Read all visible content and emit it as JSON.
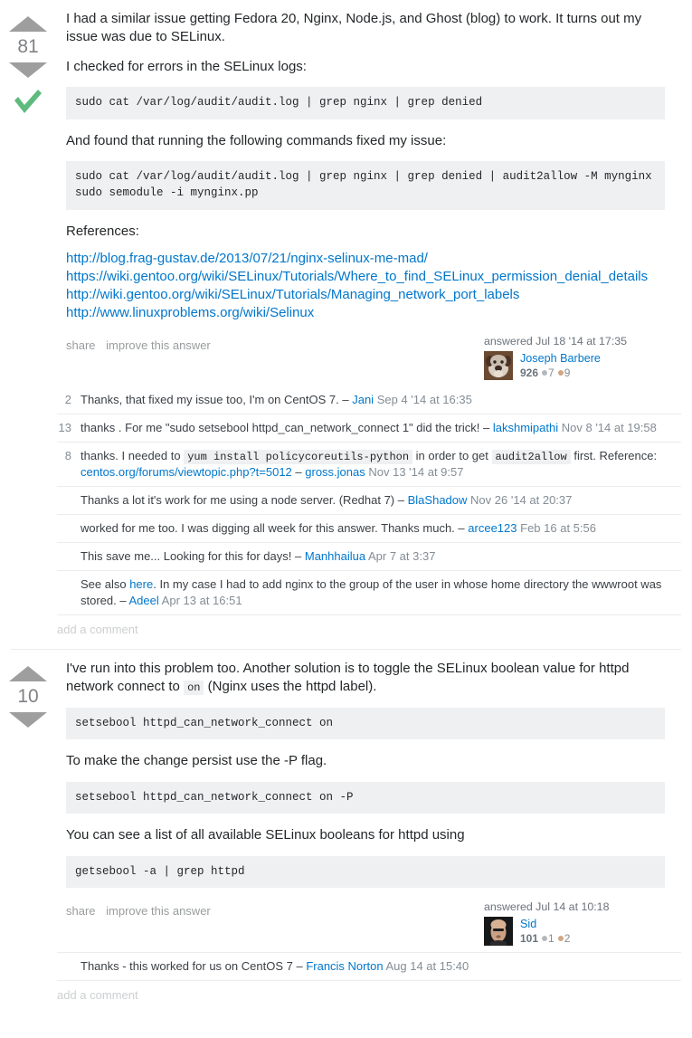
{
  "answers": [
    {
      "vote_count": "81",
      "accepted": true,
      "accept_icon": "checkmark-icon",
      "paragraphs": [
        "I had a similar issue getting Fedora 20, Nginx, Node.js, and Ghost (blog) to work. It turns out my issue was due to SELinux.",
        "I checked for errors in the SELinux logs:",
        "And found that running the following commands fixed my issue:",
        "References:"
      ],
      "code_blocks": [
        "sudo cat /var/log/audit/audit.log | grep nginx | grep denied",
        "sudo cat /var/log/audit/audit.log | grep nginx | grep denied | audit2allow -M mynginx\nsudo semodule -i mynginx.pp"
      ],
      "references": [
        "http://blog.frag-gustav.de/2013/07/21/nginx-selinux-me-mad/",
        "https://wiki.gentoo.org/wiki/SELinux/Tutorials/Where_to_find_SELinux_permission_denial_details",
        "http://wiki.gentoo.org/wiki/SELinux/Tutorials/Managing_network_port_labels",
        "http://www.linuxproblems.org/wiki/Selinux"
      ],
      "share_label": "share",
      "improve_label": "improve this answer",
      "answered_label": "answered Jul 18 '14 at 17:35",
      "user": {
        "name": "Joseph Barbere",
        "reputation": "926",
        "silver_badges": "7",
        "bronze_badges": "9",
        "avatar_alt": "dog-avatar"
      },
      "comments": [
        {
          "score": "2",
          "text": "Thanks, that fixed my issue too, I'm on CentOS 7.",
          "dash": "–",
          "user": "Jani",
          "date": "Sep 4 '14 at 16:35"
        },
        {
          "score": "13",
          "text": "thanks . For me \"sudo setsebool httpd_can_network_connect 1\" did the trick!",
          "dash": "–",
          "user": "lakshmipathi",
          "date": "Nov 8 '14 at 19:58"
        },
        {
          "score": "8",
          "text_parts": {
            "pre": "thanks. I needed to ",
            "code1": "yum install policycoreutils-python",
            "mid": " in order to get ",
            "code2": "audit2allow",
            "post": " first. Reference: ",
            "link": "centos.org/forums/viewtopic.php?t=5012"
          },
          "dash": "–",
          "user": "gross.jonas",
          "date": "Nov 13 '14 at 9:57"
        },
        {
          "score": "",
          "text": "Thanks a lot it's work for me using a node server. (Redhat 7)",
          "dash": "–",
          "user": "BlaShadow",
          "date": "Nov 26 '14 at 20:37"
        },
        {
          "score": "",
          "text": "worked for me too. I was digging all week for this answer. Thanks much.",
          "dash": "–",
          "user": "arcee123",
          "date": "Feb 16 at 5:56"
        },
        {
          "score": "",
          "text": "This save me... Looking for this for days!",
          "dash": "–",
          "user": "Manhhailua",
          "date": "Apr 7 at 3:37"
        },
        {
          "score": "",
          "text_parts": {
            "pre": "See also ",
            "link": "here",
            "post": ". In my case I had to add nginx to the group of the user in whose home directory the wwwroot was stored."
          },
          "dash": "–",
          "user": "Adeel",
          "date": "Apr 13 at 16:51"
        }
      ],
      "add_comment_label": "add a comment"
    },
    {
      "vote_count": "10",
      "accepted": false,
      "paragraphs": [
        "To make the change persist use the -P flag.",
        "You can see a list of all available SELinux booleans for httpd using"
      ],
      "intro_parts": {
        "pre": "I've run into this problem too. Another solution is to toggle the SELinux boolean value for httpd network connect to ",
        "code": "on",
        "post": " (Nginx uses the httpd label)."
      },
      "code_blocks": [
        "setsebool httpd_can_network_connect on",
        "setsebool httpd_can_network_connect on -P",
        "getsebool -a | grep httpd"
      ],
      "share_label": "share",
      "improve_label": "improve this answer",
      "answered_label": "answered Jul 14 at 10:18",
      "user": {
        "name": "Sid",
        "reputation": "101",
        "silver_badges": "1",
        "bronze_badges": "2",
        "avatar_alt": "person-avatar"
      },
      "comments": [
        {
          "score": "",
          "text": "Thanks - this worked for us on CentOS 7",
          "dash": "–",
          "user": "Francis Norton",
          "date": "Aug 14 at 15:40"
        }
      ],
      "add_comment_label": "add a comment"
    }
  ],
  "colors": {
    "link": "#0077cc",
    "accept_green": "#5eba7d",
    "vote_arrow": "#9e9e9e",
    "code_bg": "#eff0f1",
    "muted": "#848d95"
  }
}
